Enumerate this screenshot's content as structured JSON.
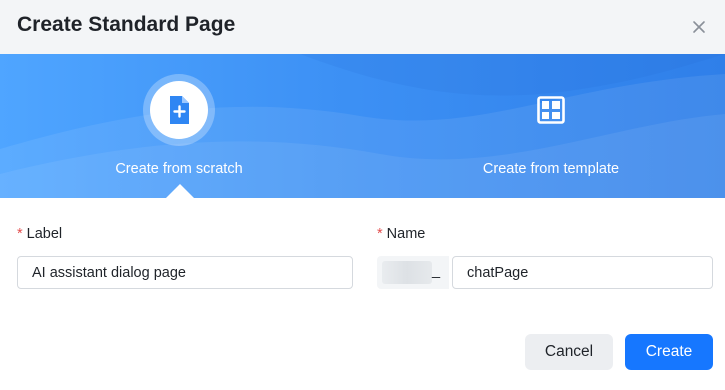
{
  "dialog": {
    "title": "Create Standard Page",
    "close_icon": "close-icon"
  },
  "options": {
    "scratch": {
      "label": "Create from scratch",
      "icon": "new-file-icon",
      "selected": true
    },
    "template": {
      "label": "Create from template",
      "icon": "layout-template-icon",
      "selected": false
    }
  },
  "form": {
    "label_field": {
      "required_mark": "*",
      "label": "Label",
      "value": "AI assistant dialog page"
    },
    "name_field": {
      "required_mark": "*",
      "label": "Name",
      "prefix_suffix": "_",
      "value": "chatPage"
    }
  },
  "buttons": {
    "cancel": "Cancel",
    "create": "Create"
  },
  "colors": {
    "primary": "#1677ff",
    "banner_start": "#4fa5ff",
    "banner_end": "#2f7fe9",
    "required": "#e34d4d"
  }
}
